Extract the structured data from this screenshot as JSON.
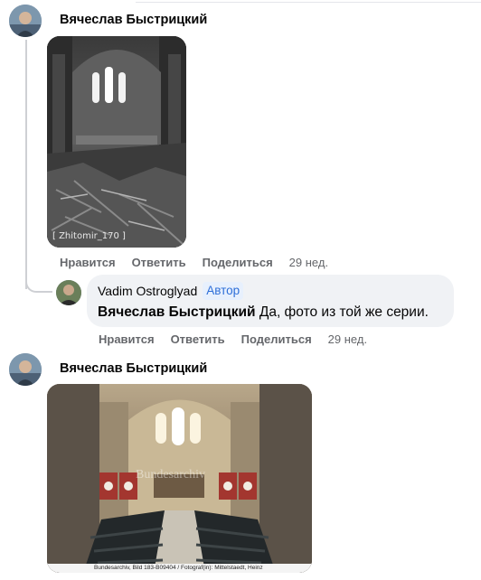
{
  "comments": [
    {
      "author": "Вячеслав Быстрицкий",
      "photo_caption": "[ Zhitomir_170 ]",
      "actions": {
        "like": "Нравится",
        "reply": "Ответить",
        "share": "Поделиться",
        "time": "29 нед."
      }
    },
    {
      "author": "Вячеслав Быстрицкий",
      "photo_caption": "Bundesarchiv, Bild 183-B09404 / Fotograf(in): Mittelstaedt, Heinz",
      "watermark": "Bundesarchiv"
    }
  ],
  "reply": {
    "author": "Vadim Ostroglyad",
    "badge": "Автор",
    "mention": "Вячеслав Быстрицкий",
    "text": " Да, фото из той же серии.",
    "actions": {
      "like": "Нравится",
      "reply": "Ответить",
      "share": "Поделиться",
      "time": "29 нед."
    }
  }
}
